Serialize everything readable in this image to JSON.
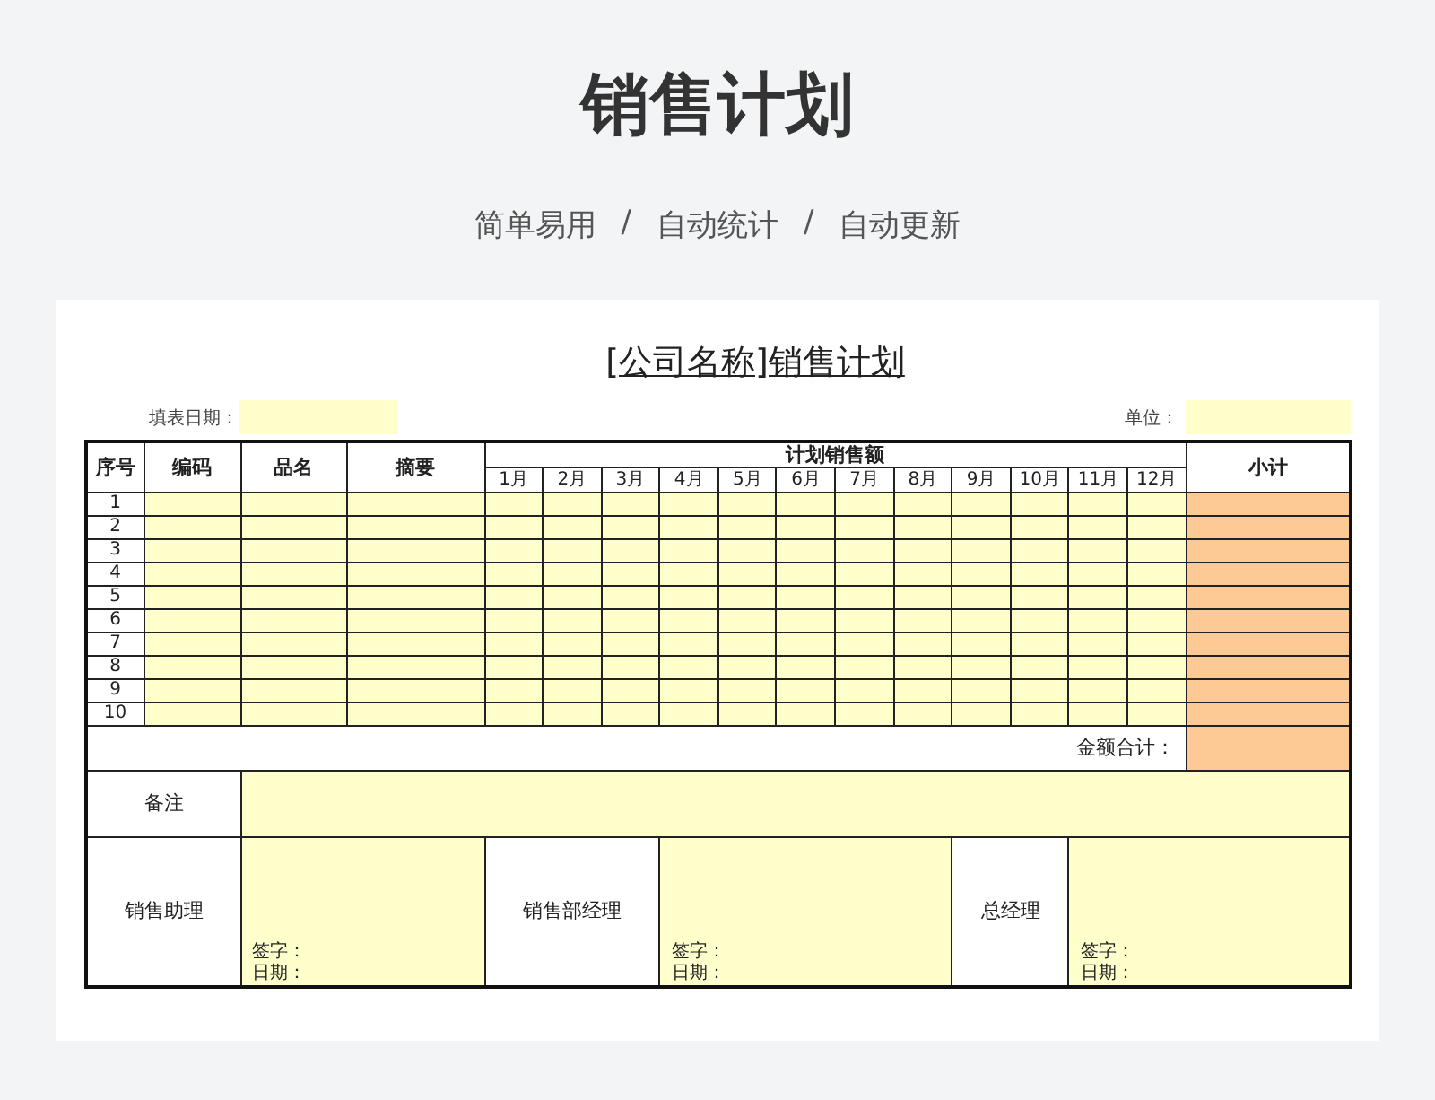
{
  "header": {
    "title": "销售计划",
    "subtitle": [
      "简单易用",
      "/",
      "自动统计",
      "/",
      "自动更新"
    ]
  },
  "sheet": {
    "title": "[公司名称]销售计划",
    "date_label": "填表日期：",
    "unit_label": "单位：",
    "columns": [
      "序号",
      "编码",
      "品名",
      "摘要"
    ],
    "group_label": "计划销售额",
    "months": [
      "1月",
      "2月",
      "3月",
      "4月",
      "5月",
      "6月",
      "7月",
      "8月",
      "9月",
      "10月",
      "11月",
      "12月"
    ],
    "subtotal_label": "小计",
    "rows": [
      "1",
      "2",
      "3",
      "4",
      "5",
      "6",
      "7",
      "8",
      "9",
      "10"
    ],
    "total_label": "金额合计：",
    "remarks_label": "备注",
    "signatures": [
      {
        "title": "销售助理",
        "sign_label": "签字：",
        "date_label": "日期："
      },
      {
        "title": "销售部经理",
        "sign_label": "签字：",
        "date_label": "日期："
      },
      {
        "title": "总经理",
        "sign_label": "签字：",
        "date_label": "日期："
      }
    ]
  }
}
